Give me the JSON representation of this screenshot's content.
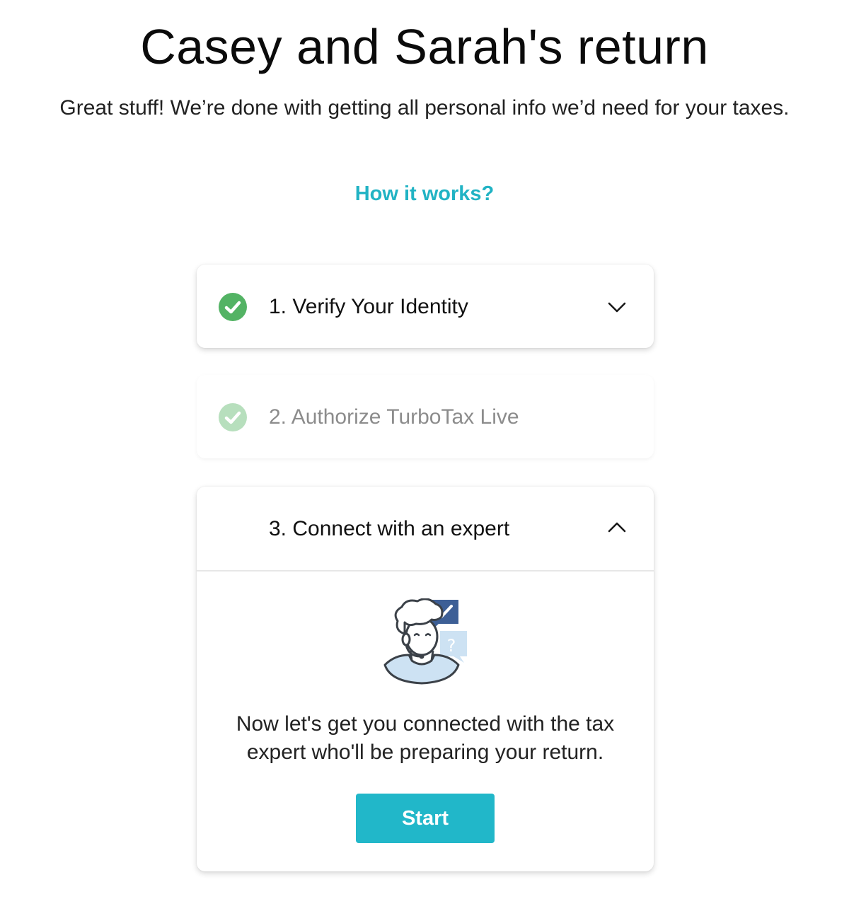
{
  "header": {
    "title": "Casey and Sarah's return",
    "subtitle": "Great stuff! We’re done with getting all personal info we’d need for your taxes."
  },
  "how_it_works": {
    "label": "How it works?"
  },
  "steps": [
    {
      "label": "1. Verify Your Identity",
      "status": "complete",
      "icon": "check-circle-icon",
      "chevron": "chevron-down-icon"
    },
    {
      "label": "2. Authorize TurboTax Live",
      "status": "complete-disabled",
      "icon": "check-circle-icon"
    },
    {
      "label": "3. Connect with an expert",
      "status": "active-expanded",
      "chevron": "chevron-up-icon",
      "illustration": "tax-expert-chat-icon",
      "body_text": "Now let's get you connected with the tax expert who'll be preparing your return.",
      "button_label": "Start"
    }
  ],
  "colors": {
    "accent": "#21b7c9",
    "link": "#21b3c4",
    "check_green": "#53b364",
    "check_green_faded": "#b7dfbd",
    "illustration_navy": "#3d5f96",
    "illustration_light_blue": "#cde2f3"
  }
}
